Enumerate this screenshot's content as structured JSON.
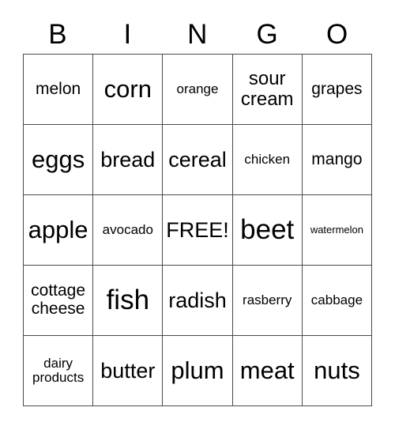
{
  "card": {
    "header_letters": [
      "B",
      "I",
      "N",
      "G",
      "O"
    ],
    "columns": 5,
    "rows": 5,
    "free_space_label": "FREE!",
    "free_space_position": {
      "row": 3,
      "column": 3
    },
    "border_color": "#4a4a4a",
    "text_color": "#000000",
    "background_color": "#ffffff",
    "cells": [
      [
        {
          "text": "melon",
          "size": "md",
          "lines": 1
        },
        {
          "text": "corn",
          "size": "xxl",
          "lines": 1
        },
        {
          "text": "orange",
          "size": "sm",
          "lines": 1
        },
        {
          "text": "sour\ncream",
          "size": "lg",
          "lines": 2
        },
        {
          "text": "grapes",
          "size": "md",
          "lines": 1
        }
      ],
      [
        {
          "text": "eggs",
          "size": "xxl",
          "lines": 1
        },
        {
          "text": "bread",
          "size": "xl",
          "lines": 1
        },
        {
          "text": "cereal",
          "size": "xl",
          "lines": 1
        },
        {
          "text": "chicken",
          "size": "sm",
          "lines": 1
        },
        {
          "text": "mango",
          "size": "md",
          "lines": 1
        }
      ],
      [
        {
          "text": "apple",
          "size": "xxl",
          "lines": 1
        },
        {
          "text": "avocado",
          "size": "sm",
          "lines": 1
        },
        {
          "text": "FREE!",
          "size": "xl",
          "lines": 1
        },
        {
          "text": "beet",
          "size": "xxxl",
          "lines": 1
        },
        {
          "text": "watermelon",
          "size": "xs",
          "lines": 1
        }
      ],
      [
        {
          "text": "cottage\ncheese",
          "size": "md",
          "lines": 2
        },
        {
          "text": "fish",
          "size": "xxxl",
          "lines": 1
        },
        {
          "text": "radish",
          "size": "xl",
          "lines": 1
        },
        {
          "text": "rasberry",
          "size": "sm",
          "lines": 1
        },
        {
          "text": "cabbage",
          "size": "sm",
          "lines": 1
        }
      ],
      [
        {
          "text": "dairy\nproducts",
          "size": "sm",
          "lines": 2
        },
        {
          "text": "butter",
          "size": "xl",
          "lines": 1
        },
        {
          "text": "plum",
          "size": "xxl",
          "lines": 1
        },
        {
          "text": "meat",
          "size": "xxl",
          "lines": 1
        },
        {
          "text": "nuts",
          "size": "xxl",
          "lines": 1
        }
      ]
    ]
  }
}
